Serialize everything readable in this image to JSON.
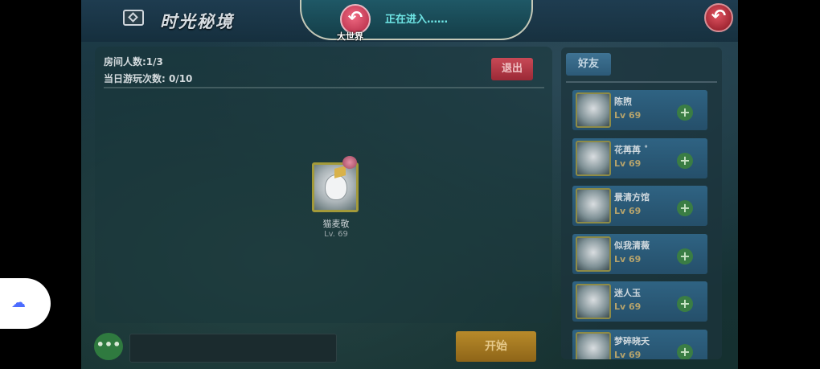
{
  "header": {
    "title": "时光秘境",
    "world_button_label": "大世界",
    "status_text": "正在进入……"
  },
  "room": {
    "room_count": "房间人数:1/3",
    "play_count": "当日游玩次数: 0/10",
    "exit_label": "退出",
    "start_label": "开始",
    "chat_more": "•••",
    "player": {
      "name": "猫麦敬",
      "level": "Lv. 69"
    }
  },
  "friends": {
    "tab_label": "好友",
    "items": [
      {
        "name": "陈煦",
        "level": "Lv 69"
      },
      {
        "name": "花苒苒 ˚",
        "level": "Lv 69"
      },
      {
        "name": "景清方馆",
        "level": "Lv 69"
      },
      {
        "name": "似我清薇",
        "level": "Lv 69"
      },
      {
        "name": "迷人玉",
        "level": "Lv 69"
      },
      {
        "name": "梦碎晓夭",
        "level": "Lv 69"
      }
    ],
    "add_glyph": "+"
  },
  "icons": {
    "back": "↶",
    "world": "↶",
    "float": "☁"
  }
}
